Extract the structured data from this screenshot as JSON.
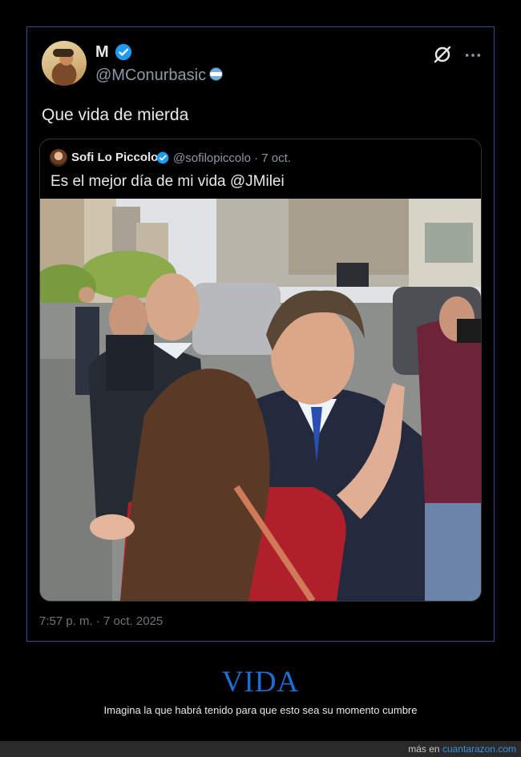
{
  "tweet": {
    "display_name": "M",
    "handle": "@MConurbasic",
    "text": "Que vida de mierda",
    "timestamp": "7:57 p. m. · 7 oct. 2025",
    "icons": [
      "grok-icon",
      "more-icon",
      "verified-badge-icon"
    ],
    "verified_color": "#1d9bf0"
  },
  "quote": {
    "display_name": "Sofi Lo Piccolo",
    "handle_date": "@sofilopiccolo · 7 oct.",
    "text": "Es el mejor día de mi vida @JMilei",
    "photo": "street-crowd-photo"
  },
  "caption": {
    "title": "VIDA",
    "subtitle": "Imagina la que habrá tenido para que esto sea su momento cumbre"
  },
  "footer": {
    "prefix": "más en ",
    "site": "cuantarazon.com"
  },
  "colors": {
    "accent": "#1d6fd6",
    "border": "#2f4f86",
    "muted": "#8b98a5"
  }
}
